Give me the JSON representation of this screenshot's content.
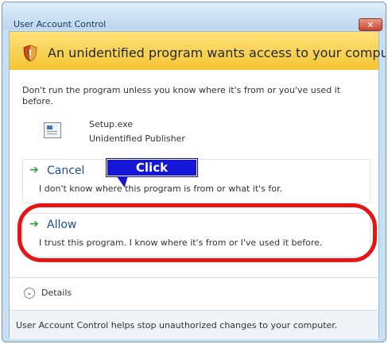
{
  "window": {
    "title": "User Account Control",
    "close_label": "✕"
  },
  "banner": {
    "text": "An unidentified program wants access to your computer"
  },
  "description": "Don't run the program unless you know where it's from or you've used it before.",
  "program": {
    "name": "Setup.exe",
    "publisher": "Unidentified Publisher"
  },
  "options": {
    "cancel": {
      "title": "Cancel",
      "description": "I don't know where this program is from or what it's for."
    },
    "allow": {
      "title": "Allow",
      "description": "I trust this program. I know where it's from or I've used it before."
    }
  },
  "details": {
    "label": "Details"
  },
  "footer": {
    "text": "User Account Control helps stop unauthorized changes to your computer."
  },
  "annotation": {
    "callout_text": "Click",
    "callout_color": "#1717d9",
    "highlight_color": "#e41515"
  },
  "icons": {
    "shield": "uac-shield-icon",
    "program": "program-icon",
    "option_arrow": "green-arrow-icon",
    "details": "chevron-down-icon"
  }
}
